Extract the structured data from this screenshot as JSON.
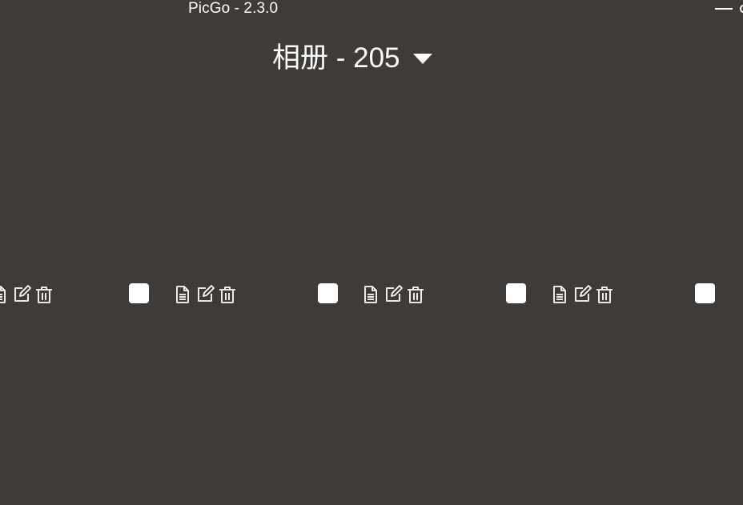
{
  "window": {
    "title": "PicGo - 2.3.0"
  },
  "gallery": {
    "title": "相册 - 205"
  },
  "icons": {
    "copy": "document-icon",
    "edit": "edit-icon",
    "delete": "trash-icon",
    "dropdown": "caret-down-icon",
    "minimize": "minimize-icon"
  },
  "colors": {
    "background": "#3e3b38",
    "foreground": "#ffffff"
  }
}
